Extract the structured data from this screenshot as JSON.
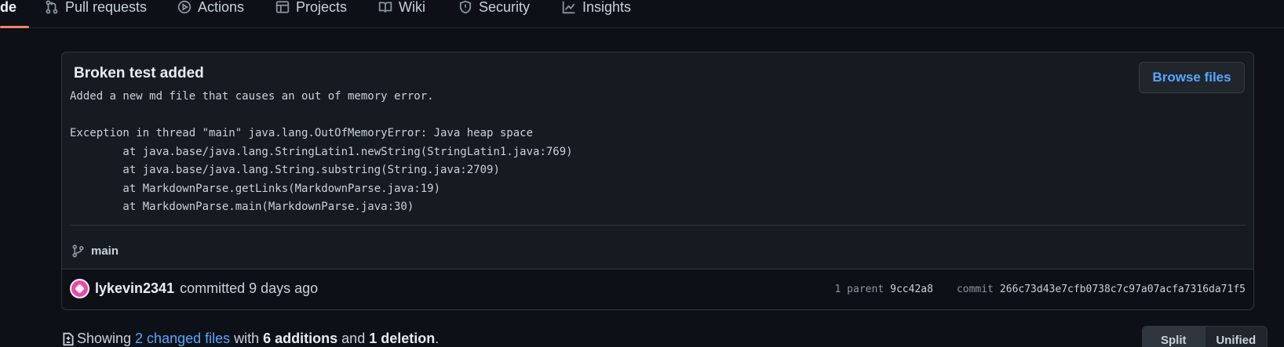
{
  "nav": {
    "items": [
      {
        "label": "de",
        "icon": "code-icon",
        "active": true
      },
      {
        "label": "Pull requests",
        "icon": "git-pull-request-icon"
      },
      {
        "label": "Actions",
        "icon": "play-icon"
      },
      {
        "label": "Projects",
        "icon": "table-icon"
      },
      {
        "label": "Wiki",
        "icon": "book-icon"
      },
      {
        "label": "Security",
        "icon": "shield-icon"
      },
      {
        "label": "Insights",
        "icon": "graph-icon"
      }
    ],
    "accent": "#f78166"
  },
  "commit": {
    "title": "Broken test added",
    "browse_label": "Browse files",
    "description": "Added a new md file that causes an out of memory error.\n\nException in thread \"main\" java.lang.OutOfMemoryError: Java heap space\n        at java.base/java.lang.StringLatin1.newString(StringLatin1.java:769)\n        at java.base/java.lang.String.substring(String.java:2709)\n        at MarkdownParse.getLinks(MarkdownParse.java:19)\n        at MarkdownParse.main(MarkdownParse.java:30)",
    "branch": "main",
    "author": "lykevin2341",
    "action": "committed 9 days ago",
    "parent_label": "1 parent",
    "parent_sha": "9cc42a8",
    "commit_label": "commit",
    "commit_sha": "266c73d43e7cfb0738c7c97a07acfa7316da71f5"
  },
  "summary": {
    "showing": "Showing",
    "changed_files": "2 changed files",
    "with": "with",
    "additions": "6 additions",
    "and": "and",
    "deletion": "1 deletion",
    "period": "."
  },
  "view_toggle": {
    "split": "Split",
    "unified": "Unified"
  },
  "colors": {
    "background": "#0d1117",
    "link": "#58a6ff",
    "avatar": "#ea4aaa"
  }
}
